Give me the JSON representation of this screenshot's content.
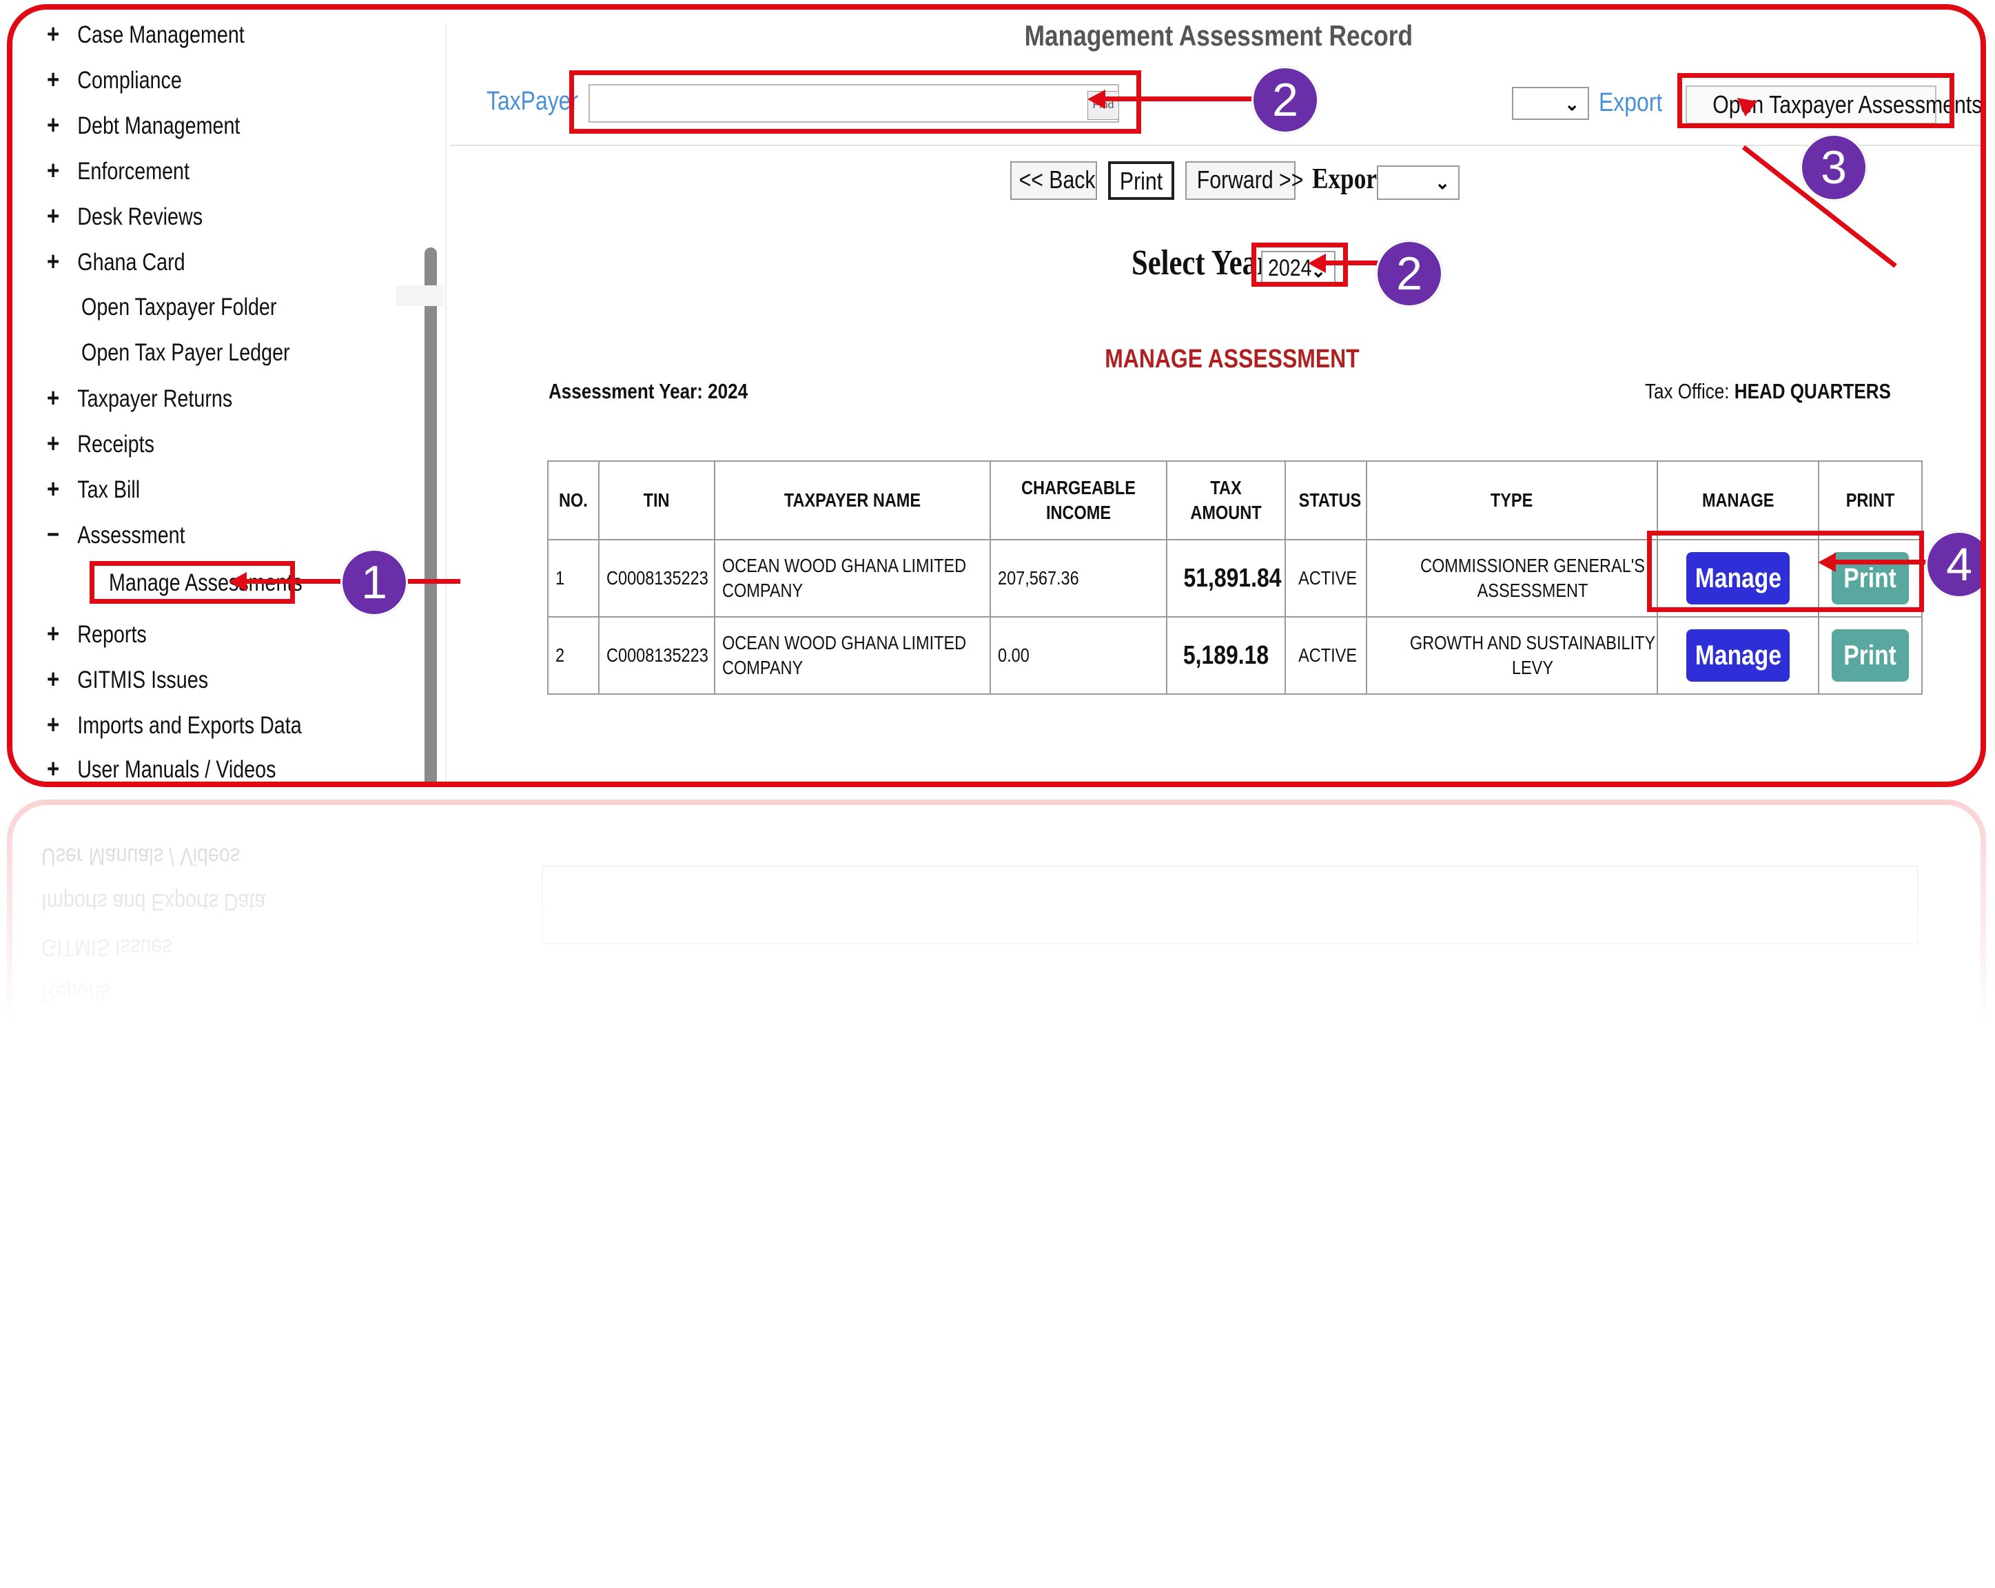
{
  "sidebar": {
    "items": [
      {
        "sign": "+",
        "label": "Case Management"
      },
      {
        "sign": "+",
        "label": "Compliance"
      },
      {
        "sign": "+",
        "label": "Debt Management"
      },
      {
        "sign": "+",
        "label": "Enforcement"
      },
      {
        "sign": "+",
        "label": "Desk Reviews"
      },
      {
        "sign": "+",
        "label": "Ghana Card"
      },
      {
        "sign": "",
        "label": "Open Taxpayer Folder"
      },
      {
        "sign": "",
        "label": "Open Tax Payer Ledger"
      },
      {
        "sign": "+",
        "label": "Taxpayer Returns"
      },
      {
        "sign": "+",
        "label": "Receipts"
      },
      {
        "sign": "+",
        "label": "Tax Bill"
      },
      {
        "sign": "−",
        "label": "Assessment"
      },
      {
        "sign": "",
        "label": "Manage Assessments"
      },
      {
        "sign": "+",
        "label": "Reports"
      },
      {
        "sign": "+",
        "label": "GITMIS Issues"
      },
      {
        "sign": "+",
        "label": "Imports and Exports Data"
      },
      {
        "sign": "+",
        "label": "User Manuals / Videos"
      }
    ]
  },
  "header": {
    "title": "Management Assessment Record",
    "taxpayer_label": "TaxPayer",
    "taxpayer_value": "",
    "find_label": "Find",
    "export_link": "Export",
    "open_button": "Open Taxpayer Assessments"
  },
  "toolbar": {
    "back": "<< Back",
    "print": "Print",
    "forward": "Forward >>",
    "export_label": "Export"
  },
  "year": {
    "label": "Select Year",
    "value": "2024"
  },
  "report": {
    "heading": "MANAGE ASSESSMENT",
    "assessment_year": "Assessment Year: 2024",
    "tax_office_label": "Tax Office:",
    "tax_office_value": "HEAD QUARTERS"
  },
  "table": {
    "headers": [
      "NO.",
      "TIN",
      "TAXPAYER NAME",
      "CHARGEABLE INCOME",
      "TAX AMOUNT",
      "STATUS",
      "TYPE",
      "MANAGE",
      "PRINT"
    ],
    "rows": [
      {
        "no": "1",
        "tin": "C0008135223",
        "name": "OCEAN WOOD GHANA LIMITED COMPANY",
        "income": "207,567.36",
        "amount": "51,891.84",
        "status": "ACTIVE",
        "type": "COMMISSIONER GENERAL'S ASSESSMENT",
        "manage": "Manage",
        "print": "Print"
      },
      {
        "no": "2",
        "tin": "C0008135223",
        "name": "OCEAN WOOD GHANA LIMITED COMPANY",
        "income": "0.00",
        "amount": "5,189.18",
        "status": "ACTIVE",
        "type": "GROWTH AND SUSTAINABILITY LEVY",
        "manage": "Manage",
        "print": "Print"
      }
    ]
  },
  "annotations": {
    "step1": "1",
    "step2a": "2",
    "step2b": "2",
    "step3": "3",
    "step4": "4"
  },
  "colors": {
    "highlight": "#e00a14",
    "badge": "#6a2fa8",
    "manage_button": "#2f2fd8",
    "print_button": "#59a8a0",
    "link": "#4a90d9",
    "heading": "#b02020"
  }
}
